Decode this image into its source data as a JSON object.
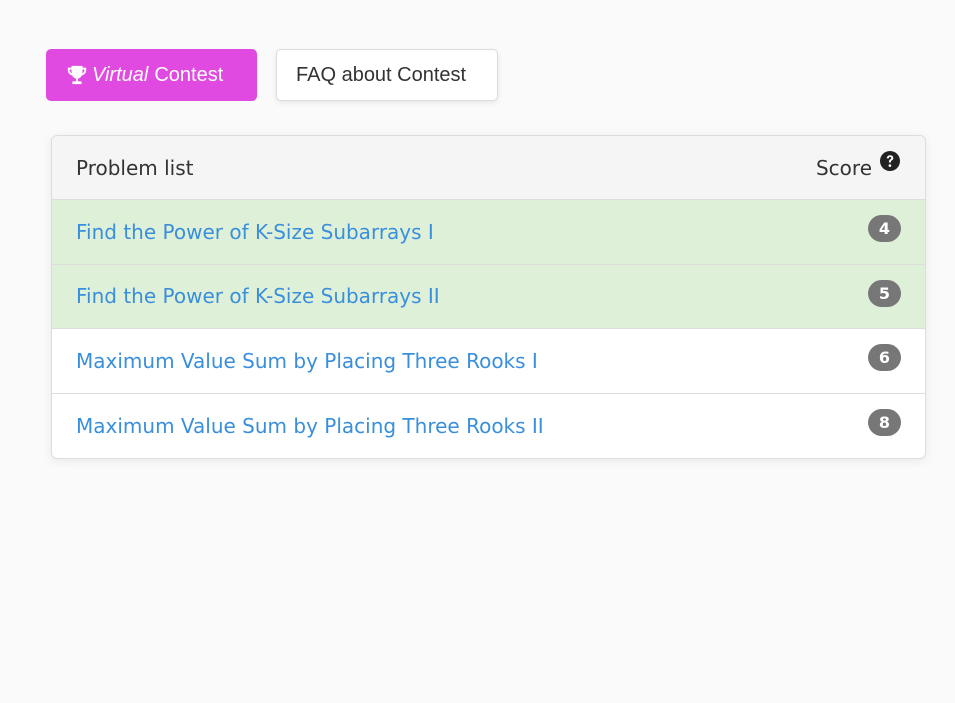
{
  "toolbar": {
    "virtual_button": {
      "icon": "trophy-icon",
      "italic_label": "Virtual",
      "label": "Contest",
      "color": "#e04ae0"
    },
    "faq_button": {
      "label": "FAQ about Contest"
    }
  },
  "problem_list": {
    "header_title": "Problem list",
    "header_score": "Score",
    "help_icon": "question-circle-icon",
    "solved_color": "#dff0d8",
    "link_color": "#3a8fdc",
    "rows": [
      {
        "title": "Find the Power of K-Size Subarrays I",
        "score": "4",
        "solved": true
      },
      {
        "title": "Find the Power of K-Size Subarrays II",
        "score": "5",
        "solved": true
      },
      {
        "title": "Maximum Value Sum by Placing Three Rooks I",
        "score": "6",
        "solved": false
      },
      {
        "title": "Maximum Value Sum by Placing Three Rooks II",
        "score": "8",
        "solved": false
      }
    ]
  }
}
